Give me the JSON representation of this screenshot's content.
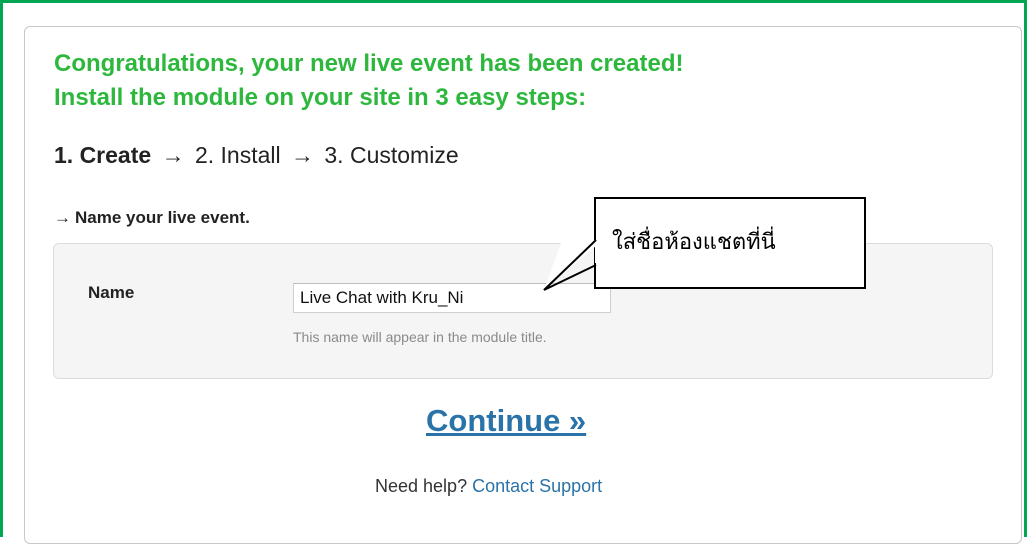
{
  "headline": {
    "line1": "Congratulations, your new live event has been created!",
    "line2": "Install the module on your site in 3 easy steps:"
  },
  "steps": {
    "step1": "1. Create",
    "step2": "2. Install",
    "step3": "3. Customize",
    "arrow": "→"
  },
  "section": {
    "arrow": "→",
    "label": "Name your live event."
  },
  "form": {
    "name_label": "Name",
    "name_value": "Live Chat with Kru_Ni",
    "help": "This name will appear in the module title."
  },
  "callout": {
    "text": "ใส่ชื่อห้องแชตที่นี่"
  },
  "actions": {
    "continue": "Continue »",
    "need_help": "Need help?",
    "contact_support": "Contact Support"
  },
  "colors": {
    "frame": "#00a651",
    "headline": "#2db83d",
    "link": "#2a73a8"
  }
}
